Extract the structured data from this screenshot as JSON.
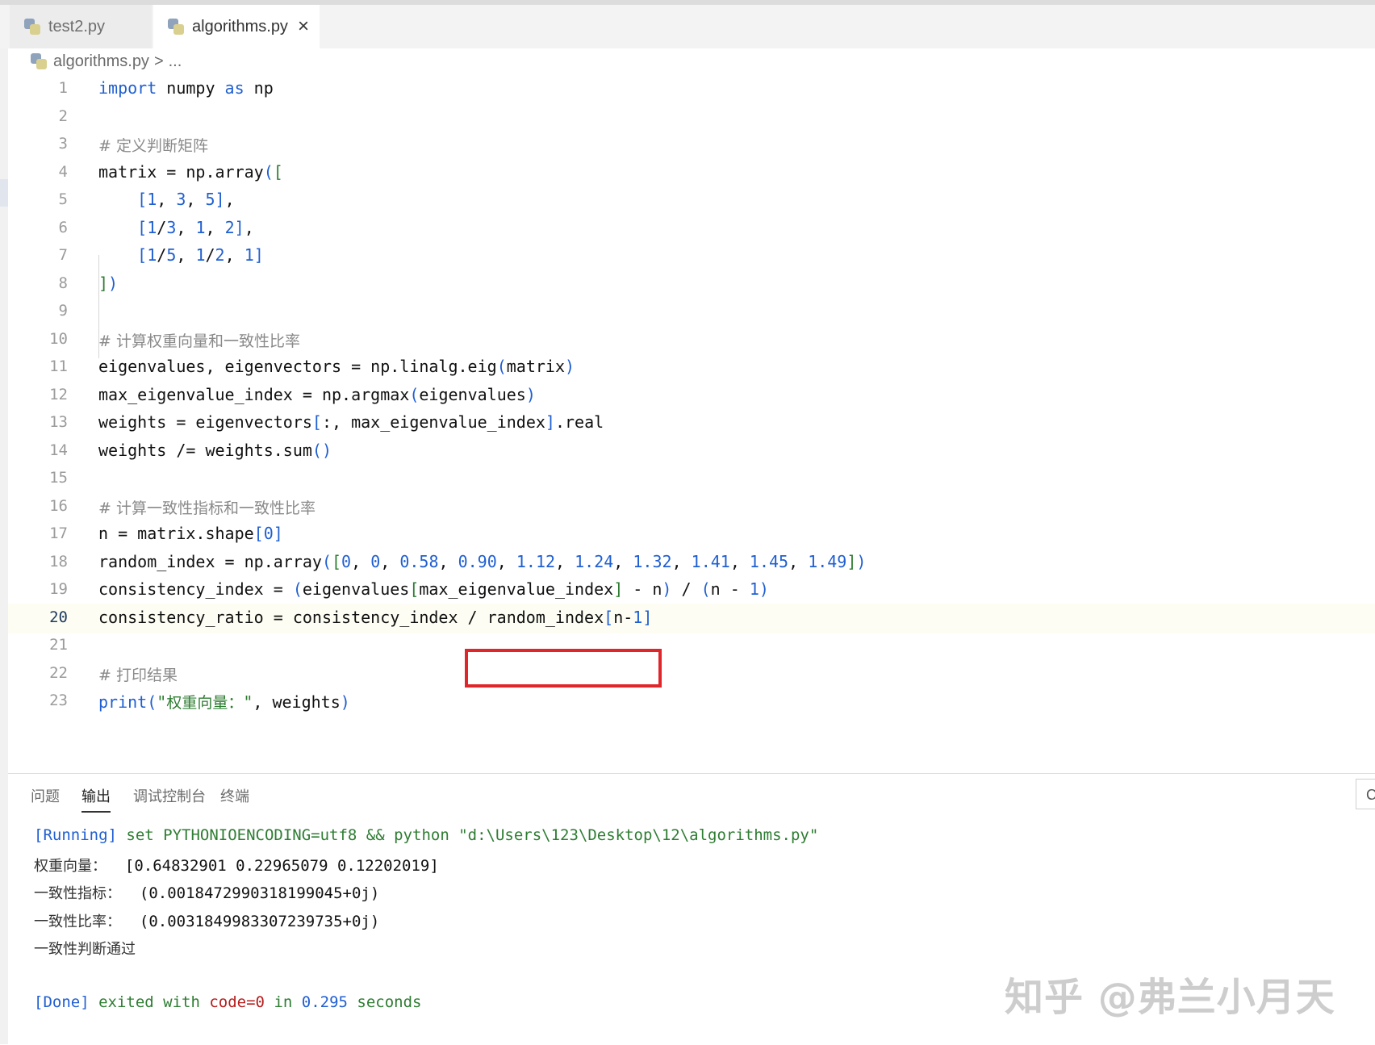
{
  "tabs": [
    {
      "label": "test2.py"
    },
    {
      "label": "algorithms.py",
      "close": "×"
    }
  ],
  "breadcrumb": {
    "file": "algorithms.py",
    "sep": ">",
    "more": "..."
  },
  "code_lines": [
    {
      "n": "1",
      "tokens": [
        {
          "t": "import",
          "c": "kw"
        },
        {
          "t": " numpy "
        },
        {
          "t": "as",
          "c": "kw"
        },
        {
          "t": " np"
        }
      ]
    },
    {
      "n": "2",
      "tokens": []
    },
    {
      "n": "3",
      "tokens": [
        {
          "t": "# 定义判断矩阵",
          "c": "cm"
        }
      ]
    },
    {
      "n": "4",
      "tokens": [
        {
          "t": "matrix = np.array"
        },
        {
          "t": "(",
          "c": "br"
        },
        {
          "t": "[",
          "c": "str"
        }
      ]
    },
    {
      "n": "5",
      "tokens": [
        {
          "t": "    "
        },
        {
          "t": "[",
          "c": "br"
        },
        {
          "t": "1",
          "c": "num"
        },
        {
          "t": ", "
        },
        {
          "t": "3",
          "c": "num"
        },
        {
          "t": ", "
        },
        {
          "t": "5",
          "c": "num"
        },
        {
          "t": "]",
          "c": "br"
        },
        {
          "t": ","
        }
      ]
    },
    {
      "n": "6",
      "tokens": [
        {
          "t": "    "
        },
        {
          "t": "[",
          "c": "br"
        },
        {
          "t": "1",
          "c": "num"
        },
        {
          "t": "/"
        },
        {
          "t": "3",
          "c": "num"
        },
        {
          "t": ", "
        },
        {
          "t": "1",
          "c": "num"
        },
        {
          "t": ", "
        },
        {
          "t": "2",
          "c": "num"
        },
        {
          "t": "]",
          "c": "br"
        },
        {
          "t": ","
        }
      ]
    },
    {
      "n": "7",
      "tokens": [
        {
          "t": "    "
        },
        {
          "t": "[",
          "c": "br"
        },
        {
          "t": "1",
          "c": "num"
        },
        {
          "t": "/"
        },
        {
          "t": "5",
          "c": "num"
        },
        {
          "t": ", "
        },
        {
          "t": "1",
          "c": "num"
        },
        {
          "t": "/"
        },
        {
          "t": "2",
          "c": "num"
        },
        {
          "t": ", "
        },
        {
          "t": "1",
          "c": "num"
        },
        {
          "t": "]",
          "c": "br"
        }
      ]
    },
    {
      "n": "8",
      "tokens": [
        {
          "t": "]",
          "c": "str"
        },
        {
          "t": ")",
          "c": "br"
        }
      ]
    },
    {
      "n": "9",
      "tokens": []
    },
    {
      "n": "10",
      "tokens": [
        {
          "t": "# 计算权重向量和一致性比率",
          "c": "cm"
        }
      ]
    },
    {
      "n": "11",
      "tokens": [
        {
          "t": "eigenvalues, eigenvectors = np.linalg.eig"
        },
        {
          "t": "(",
          "c": "br"
        },
        {
          "t": "matrix"
        },
        {
          "t": ")",
          "c": "br"
        }
      ]
    },
    {
      "n": "12",
      "tokens": [
        {
          "t": "max_eigenvalue_index = np.argmax"
        },
        {
          "t": "(",
          "c": "br"
        },
        {
          "t": "eigenvalues"
        },
        {
          "t": ")",
          "c": "br"
        }
      ]
    },
    {
      "n": "13",
      "tokens": [
        {
          "t": "weights = eigenvectors"
        },
        {
          "t": "[",
          "c": "br"
        },
        {
          "t": ":, max_eigenvalue_index"
        },
        {
          "t": "]",
          "c": "br"
        },
        {
          "t": ".real"
        }
      ]
    },
    {
      "n": "14",
      "tokens": [
        {
          "t": "weights /= weights.sum"
        },
        {
          "t": "()",
          "c": "br"
        }
      ]
    },
    {
      "n": "15",
      "tokens": []
    },
    {
      "n": "16",
      "tokens": [
        {
          "t": "# 计算一致性指标和一致性比率",
          "c": "cm"
        }
      ]
    },
    {
      "n": "17",
      "tokens": [
        {
          "t": "n = matrix.shape"
        },
        {
          "t": "[",
          "c": "br"
        },
        {
          "t": "0",
          "c": "num"
        },
        {
          "t": "]",
          "c": "br"
        }
      ]
    },
    {
      "n": "18",
      "tokens": [
        {
          "t": "random_index = np.array"
        },
        {
          "t": "(",
          "c": "br"
        },
        {
          "t": "[",
          "c": "str"
        },
        {
          "t": "0",
          "c": "num"
        },
        {
          "t": ", "
        },
        {
          "t": "0",
          "c": "num"
        },
        {
          "t": ", "
        },
        {
          "t": "0.58",
          "c": "num"
        },
        {
          "t": ", "
        },
        {
          "t": "0.90",
          "c": "num"
        },
        {
          "t": ", "
        },
        {
          "t": "1.12",
          "c": "num"
        },
        {
          "t": ", "
        },
        {
          "t": "1.24",
          "c": "num"
        },
        {
          "t": ", "
        },
        {
          "t": "1.32",
          "c": "num"
        },
        {
          "t": ", "
        },
        {
          "t": "1.41",
          "c": "num"
        },
        {
          "t": ", "
        },
        {
          "t": "1.45",
          "c": "num"
        },
        {
          "t": ", "
        },
        {
          "t": "1.49",
          "c": "num"
        },
        {
          "t": "]",
          "c": "str"
        },
        {
          "t": ")",
          "c": "br"
        }
      ]
    },
    {
      "n": "19",
      "tokens": [
        {
          "t": "consistency_index = "
        },
        {
          "t": "(",
          "c": "br"
        },
        {
          "t": "eigenvalues"
        },
        {
          "t": "[",
          "c": "str"
        },
        {
          "t": "max_eigenvalue_index"
        },
        {
          "t": "]",
          "c": "str"
        },
        {
          "t": " - n"
        },
        {
          "t": ")",
          "c": "br"
        },
        {
          "t": " / "
        },
        {
          "t": "(",
          "c": "br"
        },
        {
          "t": "n - "
        },
        {
          "t": "1",
          "c": "num"
        },
        {
          "t": ")",
          "c": "br"
        }
      ]
    },
    {
      "n": "20",
      "current": true,
      "tokens": [
        {
          "t": "consistency_ratio = consistency_index / random_index"
        },
        {
          "t": "[",
          "c": "br"
        },
        {
          "t": "n-"
        },
        {
          "t": "1",
          "c": "num"
        },
        {
          "t": "]",
          "c": "br"
        }
      ]
    },
    {
      "n": "21",
      "tokens": []
    },
    {
      "n": "22",
      "tokens": [
        {
          "t": "# 打印结果",
          "c": "cm"
        }
      ]
    },
    {
      "n": "23",
      "tokens": [
        {
          "t": "print",
          "c": "kw"
        },
        {
          "t": "(",
          "c": "br"
        },
        {
          "t": "\"",
          "c": "str"
        },
        {
          "t": "权重向量：",
          "c": "strcn"
        },
        {
          "t": "\"",
          "c": "str"
        },
        {
          "t": ", weights"
        },
        {
          "t": ")",
          "c": "br"
        }
      ]
    }
  ],
  "panel": {
    "tabs": [
      "问题",
      "输出",
      "调试控制台",
      "终端"
    ],
    "active_tab": 1,
    "side_label": "Co"
  },
  "output": {
    "running_tag": "[Running]",
    "running_cmd": " set PYTHONIOENCODING=utf8 && python \"d:\\Users\\123\\Desktop\\12\\algorithms.py\"",
    "lines": [
      {
        "label": "权重向量：",
        "value": "  [0.64832901 0.22965079 0.12202019]"
      },
      {
        "label": "一致性指标：",
        "value": "  (0.0018472990318199045+0j)"
      },
      {
        "label": "一致性比率：",
        "value": "  (0.0031849983307239735+0j)"
      },
      {
        "label": "一致性判断通过",
        "value": ""
      }
    ],
    "done_tag": "[Done]",
    "done_text1": " exited with ",
    "done_code": "code=0",
    "done_in": " in ",
    "done_time": "0.295",
    "done_secs": " seconds"
  },
  "watermark": "知乎 @弗兰小月天",
  "colors": {
    "keyword": "#1f5fd1",
    "string": "#2e7d32",
    "comment": "#8a8a8a",
    "highlight": "#e0262b"
  }
}
